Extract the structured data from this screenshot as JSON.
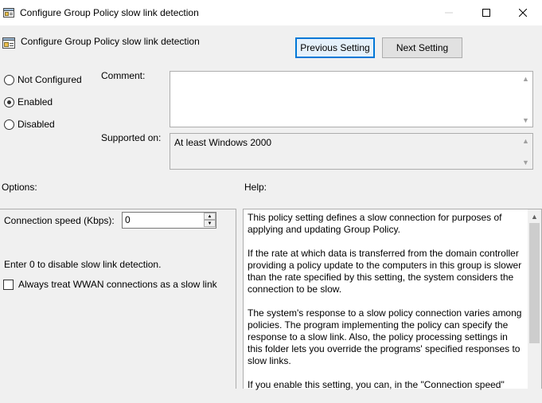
{
  "window": {
    "title": "Configure Group Policy slow link detection",
    "minimize_glyph": "—",
    "close_glyph": "✕"
  },
  "header": {
    "title": "Configure Group Policy slow link detection",
    "prev_label": "Previous Setting",
    "next_label": "Next Setting"
  },
  "state": {
    "options": [
      {
        "label": "Not Configured",
        "checked": false
      },
      {
        "label": "Enabled",
        "checked": true
      },
      {
        "label": "Disabled",
        "checked": false
      }
    ]
  },
  "comment": {
    "label": "Comment:",
    "value": ""
  },
  "supported": {
    "label": "Supported on:",
    "value": "At least Windows 2000"
  },
  "options_section": {
    "label": "Options:",
    "speed_label": "Connection speed (Kbps):",
    "speed_value": "0",
    "hint": "Enter 0 to disable slow link detection.",
    "wwan_label": "Always treat WWAN connections as a slow link",
    "wwan_checked": false
  },
  "help_section": {
    "label": "Help:",
    "paragraphs": [
      "This policy setting defines a slow connection for purposes of applying and updating Group Policy.",
      "If the rate at which data is transferred from the domain controller providing a policy update to the computers in this group is slower than the rate specified by this setting, the system considers the connection to be slow.",
      "The system's response to a slow policy connection varies among policies. The program implementing the policy can specify the response to a slow link. Also, the policy processing settings in this folder lets you override the programs' specified responses to slow links.",
      "If you enable this setting, you can, in the \"Connection speed\""
    ]
  },
  "colors": {
    "accent": "#0078d7",
    "background": "#f0f0f0",
    "border": "#adadad"
  }
}
